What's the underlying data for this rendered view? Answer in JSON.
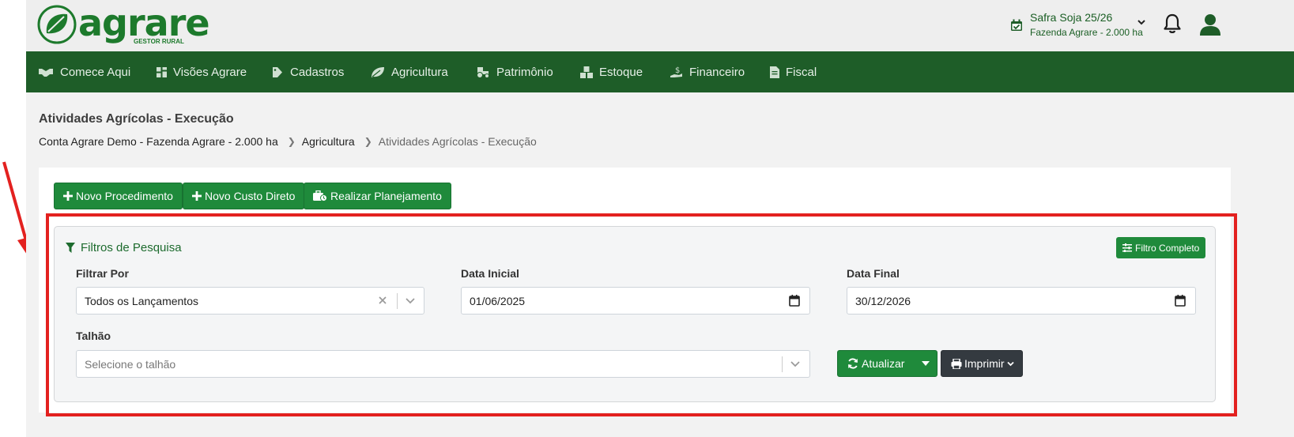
{
  "brand": {
    "name": "agrare",
    "tagline": "GESTOR RURAL"
  },
  "season": {
    "title": "Safra Soja 25/26",
    "farm": "Fazenda Agrare - 2.000 ha"
  },
  "nav": [
    {
      "label": "Comece Aqui",
      "icon": "handshake-icon"
    },
    {
      "label": "Visões Agrare",
      "icon": "dashboard-icon"
    },
    {
      "label": "Cadastros",
      "icon": "tags-icon"
    },
    {
      "label": "Agricultura",
      "icon": "leaf-icon"
    },
    {
      "label": "Patrimônio",
      "icon": "tractor-icon"
    },
    {
      "label": "Estoque",
      "icon": "boxes-icon"
    },
    {
      "label": "Financeiro",
      "icon": "hand-dollar-icon"
    },
    {
      "label": "Fiscal",
      "icon": "invoice-icon"
    }
  ],
  "page": {
    "title": "Atividades Agrícolas - Execução",
    "breadcrumb": [
      "Conta Agrare Demo - Fazenda Agrare - 2.000 ha",
      "Agricultura",
      "Atividades Agrícolas - Execução"
    ]
  },
  "actions": {
    "novo_procedimento": "Novo Procedimento",
    "novo_custo_direto": "Novo Custo Direto",
    "realizar_planejamento": "Realizar Planejamento"
  },
  "filters": {
    "title": "Filtros de Pesquisa",
    "full_filter_label": "Filtro Completo",
    "filtrar_por": {
      "label": "Filtrar Por",
      "value": "Todos os Lançamentos"
    },
    "data_inicial": {
      "label": "Data Inicial",
      "value": "01/06/2025"
    },
    "data_final": {
      "label": "Data Final",
      "value": "30/12/2026"
    },
    "talhao": {
      "label": "Talhão",
      "placeholder": "Selecione o talhão"
    },
    "atualizar_label": "Atualizar",
    "imprimir_label": "Imprimir"
  },
  "colors": {
    "primary": "#1f8a3b",
    "nav": "#1e5d28",
    "dark": "#343a40",
    "highlight": "#e3211f"
  }
}
